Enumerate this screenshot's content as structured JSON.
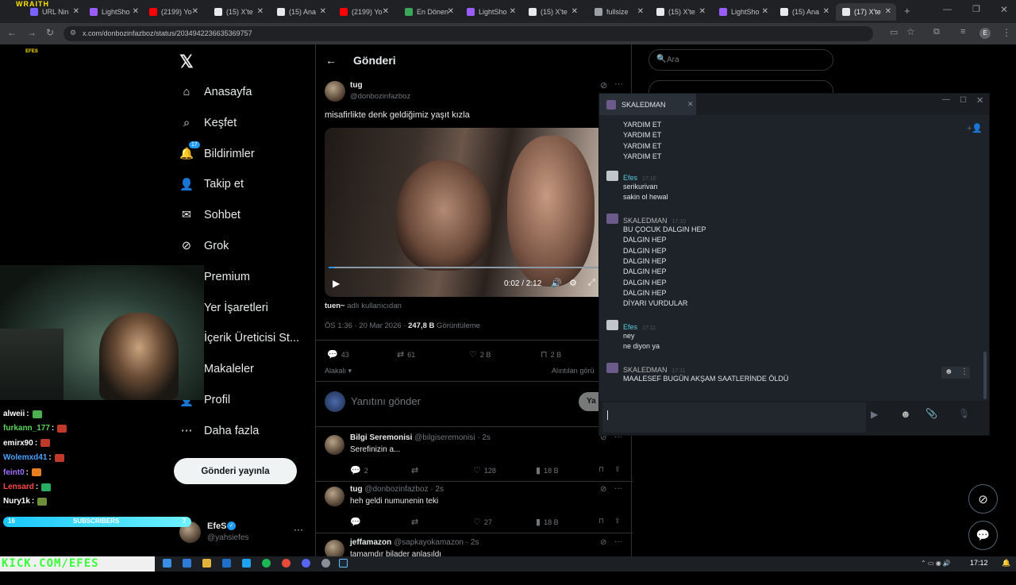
{
  "browser": {
    "tabs": [
      {
        "label": "URL Nin",
        "favicon_color": "#7b61ff"
      },
      {
        "label": "LightSho",
        "favicon_color": "#9b5cff"
      },
      {
        "label": "(2199) Yo",
        "favicon_color": "#ff0000"
      },
      {
        "label": "(15) X'te",
        "favicon_color": "#e7e9ea"
      },
      {
        "label": "(15) Ana",
        "favicon_color": "#e7e9ea"
      },
      {
        "label": "(2199) Yo",
        "favicon_color": "#ff0000"
      },
      {
        "label": "En Dönen",
        "favicon_color": "#3aa757"
      },
      {
        "label": "LightSho",
        "favicon_color": "#9b5cff"
      },
      {
        "label": "(15) X'te",
        "favicon_color": "#e7e9ea"
      },
      {
        "label": "fullsize",
        "favicon_color": "#9aa0a6"
      },
      {
        "label": "(15) X'te",
        "favicon_color": "#e7e9ea"
      },
      {
        "label": "LightSho",
        "favicon_color": "#9b5cff"
      },
      {
        "label": "(15) Ana",
        "favicon_color": "#e7e9ea"
      },
      {
        "label": "(17) X'te",
        "favicon_color": "#e7e9ea"
      }
    ],
    "url": "x.com/donbozinfazboz/status/2034942236635369757",
    "profile_initial": "E",
    "overlay_brand": "WRAITH"
  },
  "stream_overlay": {
    "logo_text": "EFES",
    "subscribers_label": "SUBSCRIBERS",
    "sub_left": "16",
    "sub_right": "7",
    "bottom_banner": "KICK.COM/EFES",
    "chat": [
      {
        "user": "alweii",
        "color": "#ffffff"
      },
      {
        "user": "furkann_177",
        "color": "#5bd45b"
      },
      {
        "user": "emirx90",
        "color": "#ffffff"
      },
      {
        "user": "Wolemxd41",
        "color": "#4aa3ff"
      },
      {
        "user": "feint0",
        "color": "#a070ff"
      },
      {
        "user": "Lensard",
        "color": "#ff4a4a"
      },
      {
        "user": "Nury1k",
        "color": "#ffffff"
      }
    ]
  },
  "x": {
    "nav": [
      {
        "label": "Anasayfa",
        "icon": "home-icon"
      },
      {
        "label": "Keşfet",
        "icon": "search-icon"
      },
      {
        "label": "Bildirimler",
        "icon": "bell-icon",
        "badge": "17"
      },
      {
        "label": "Takip et",
        "icon": "follow-icon"
      },
      {
        "label": "Sohbet",
        "icon": "mail-icon"
      },
      {
        "label": "Grok",
        "icon": "grok-icon"
      },
      {
        "label": "Premium",
        "icon": "x-icon"
      },
      {
        "label": "Yer İşaretleri",
        "icon": "bookmark-icon"
      },
      {
        "label": "İçerik Üreticisi St...",
        "icon": "creator-icon"
      },
      {
        "label": "Makaleler",
        "icon": "article-icon"
      },
      {
        "label": "Profil",
        "icon": "profile-icon"
      },
      {
        "label": "Daha fazla",
        "icon": "more-icon"
      }
    ],
    "post_button": "Gönderi yayınla",
    "account": {
      "name": "EfeS",
      "handle": "@yahsiefes"
    },
    "header_title": "Gönderi",
    "post": {
      "author": "tug",
      "handle": "@donbozinfazboz",
      "text": "misafirlikte denk geldiğimiz yaşıt kızla",
      "video_time": "0:02 / 2:12",
      "from_user": "tuen~",
      "from_suffix": "adlı kullanıcıdan",
      "meta_date": "ÖS 1:36 · 20 Mar 2026 · ",
      "views": "247,8 B",
      "views_label": "Görüntüleme",
      "replies": "43",
      "reposts": "61",
      "likes": "2 B",
      "bookmarks": "2 B",
      "related_left": "Alakalı",
      "related_right": "Alıntıları görü",
      "reply_placeholder": "Yanıtını gönder",
      "reply_button": "Ya"
    },
    "replies": [
      {
        "name": "Bilgi Seremonisi",
        "handle": "@bilgiseremonisi",
        "time": "· 2s",
        "text": "Serefinizin a...",
        "replies": "2",
        "reposts": "",
        "likes": "128",
        "views": "18 B"
      },
      {
        "name": "tug",
        "handle": "@donbozinfazboz",
        "time": "· 2s",
        "text": "heh geldi numunenin teki",
        "replies": "",
        "reposts": "",
        "likes": "27",
        "views": "18 B"
      },
      {
        "name": "jeffamazon",
        "handle": "@sapkayokamazon",
        "time": "· 2s",
        "text": "tamamdır bilader anlaşıldı",
        "replies": "",
        "reposts": "",
        "likes": "",
        "views": ""
      }
    ],
    "search_placeholder": "Ara"
  },
  "steam_chat": {
    "title": "SKALEDMAN",
    "messages": [
      {
        "name": "",
        "time": "",
        "lines": [
          "YARDIM ET",
          "YARDIM ET",
          "YARDIM ET",
          "YARDIM ET"
        ]
      },
      {
        "name": "Efes",
        "time": "17:10",
        "lines": [
          "serikurivan",
          "sakin ol hewal"
        ]
      },
      {
        "name": "SKALEDMAN",
        "time": "17:10",
        "lines": [
          "BU ÇOCUK DALGIN HEP",
          "DALGIN HEP",
          "DALGIN HEP",
          "DALGIN HEP",
          "DALGIN HEP",
          "DALGIN HEP",
          "DALGIN HEP",
          "DİYARI VURDULAR"
        ]
      },
      {
        "name": "Efes",
        "time": "17:11",
        "lines": [
          "ney",
          "ne diyon ya"
        ]
      },
      {
        "name": "SKALEDMAN",
        "time": "17:11",
        "lines": [
          "MAALESEF BUGÜN AKŞAM SAATLERİNDE ÖLDÜ"
        ]
      }
    ]
  },
  "taskbar": {
    "time": "17:12"
  }
}
